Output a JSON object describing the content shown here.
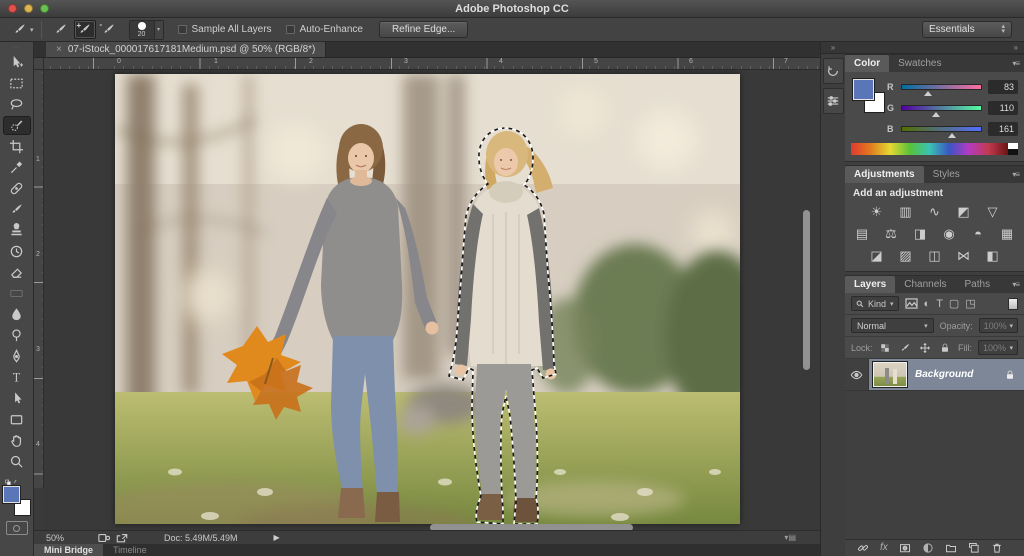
{
  "titlebar": {
    "title": "Adobe Photoshop CC"
  },
  "options_bar": {
    "brush_size": "20",
    "sample_all_layers": "Sample All Layers",
    "auto_enhance": "Auto-Enhance",
    "refine_edge": "Refine Edge...",
    "workspace": "Essentials",
    "mode_add_symbol": "+",
    "mode_subtract_symbol": "-"
  },
  "document": {
    "close_symbol": "×",
    "tab_title": "07-iStock_000017617181Medium.psd @ 50% (RGB/8*)",
    "h_ruler": [
      "0",
      "1",
      "2",
      "3",
      "4",
      "5",
      "6",
      "7"
    ],
    "v_ruler": [
      "1",
      "2",
      "3",
      "4"
    ]
  },
  "status_bar": {
    "zoom": "50%",
    "doc_info": "Doc: 5.49M/5.49M",
    "arrow": "▶",
    "menu_glyph": "▾▤"
  },
  "bottom_tabs": {
    "mini_bridge": "Mini Bridge",
    "timeline": "Timeline"
  },
  "dock_strip": {
    "collapse_left": "»",
    "collapse_right": "»"
  },
  "color_panel": {
    "tab_color": "Color",
    "tab_swatches": "Swatches",
    "menu_glyph": "▾≡",
    "foreground_hex": "#5b76b8",
    "background_hex": "#ffffff",
    "channels": [
      {
        "label": "R",
        "value": "83"
      },
      {
        "label": "G",
        "value": "110"
      },
      {
        "label": "B",
        "value": "161"
      }
    ]
  },
  "adjustments_panel": {
    "tab_adjustments": "Adjustments",
    "tab_styles": "Styles",
    "menu_glyph": "▾≡",
    "heading": "Add an adjustment",
    "row1": [
      "☀",
      "▥",
      "∿",
      "◩",
      "▽"
    ],
    "row2": [
      "▤",
      "⚖",
      "◨",
      "◉",
      "◓",
      "▦"
    ],
    "row3": [
      "◪",
      "▨",
      "◫",
      "⋈",
      "◧"
    ]
  },
  "layers_panel": {
    "tab_layers": "Layers",
    "tab_channels": "Channels",
    "tab_paths": "Paths",
    "menu_glyph": "▾≡",
    "filter_label": "Kind",
    "filter_caret": "▾",
    "filter_icons": [
      "◐",
      "T",
      "▢",
      "◳"
    ],
    "blend_mode": "Normal",
    "blend_caret": "▾",
    "opacity_label": "Opacity:",
    "opacity_value": "100%",
    "lock_label": "Lock:",
    "fill_label": "Fill:",
    "fill_value": "100%",
    "layer_name": "Background",
    "fx_label": "fx"
  }
}
